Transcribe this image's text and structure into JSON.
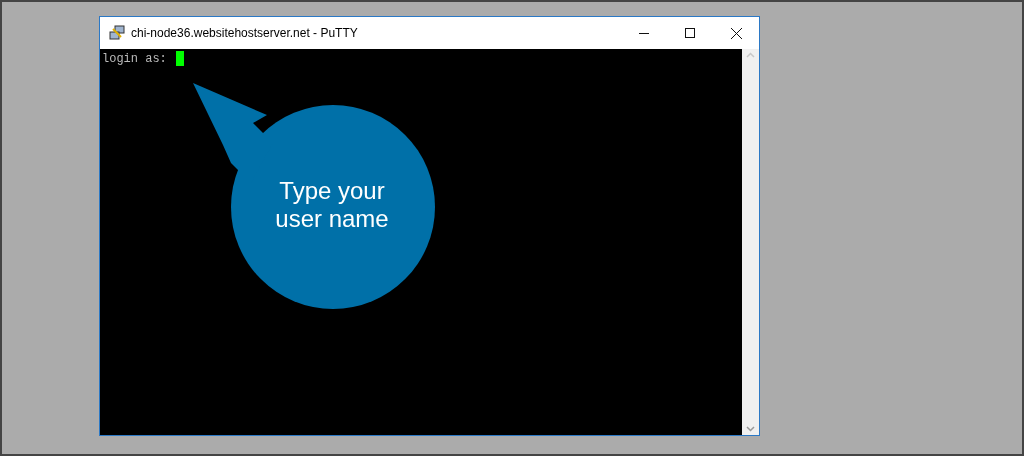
{
  "window": {
    "title": "chi-node36.websitehostserver.net - PuTTY"
  },
  "terminal": {
    "prompt": "login as:"
  },
  "callout": {
    "text": "Type your user name"
  }
}
